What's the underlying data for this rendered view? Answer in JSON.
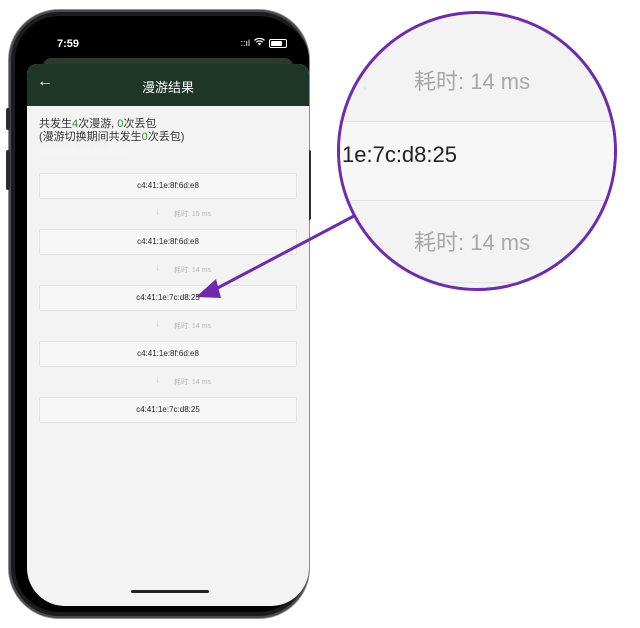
{
  "status": {
    "time": "7:59",
    "signal": "::ıl"
  },
  "nav": {
    "back_label": "←",
    "title": "漫游结果"
  },
  "summary": {
    "prefix": "共发生",
    "roam_count": "4",
    "roam_suffix": "次漫游,",
    "drop_count": "0",
    "drop_suffix": "次丢包",
    "line2_prefix": "(漫游切换期间共发生",
    "line2_count": "0",
    "line2_suffix": "次丢包)",
    "timestamp": "2020-05-10 18:51:50"
  },
  "steps": [
    {
      "mac": "c4:41:1e:8f:6d:e8",
      "duration": "耗时: 15 ms"
    },
    {
      "mac": "c4:41:1e:8f:6d:e8",
      "duration": "耗时: 14 ms"
    },
    {
      "mac": "c4:41:1e:7c:d8:25",
      "duration": "耗时: 14 ms"
    },
    {
      "mac": "c4:41:1e:8f:6d:e8",
      "duration": "耗时: 14 ms"
    },
    {
      "mac": "c4:41:1e:7c:d8:25"
    }
  ],
  "magnifier": {
    "top_time": "耗时: 14 ms",
    "value": "1e:7c:d8:25",
    "bottom_time": "耗时: 14 ms"
  },
  "colors": {
    "accent": "#6e2bb0",
    "navbar": "#1e3627",
    "highlight": "#2e8b3a"
  }
}
